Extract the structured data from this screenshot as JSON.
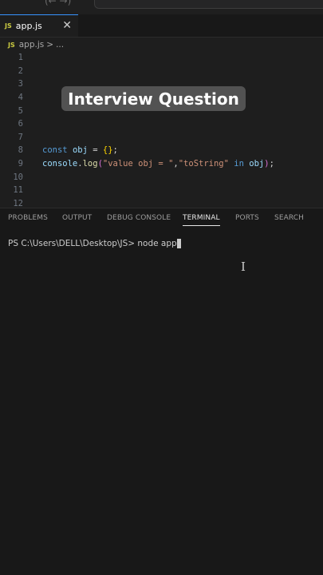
{
  "titlebar": {
    "nav_text": "(← →)"
  },
  "tab": {
    "icon": "JS",
    "label": "app.js",
    "close": "✕"
  },
  "breadcrumb": {
    "icon": "JS",
    "file": "app.js",
    "separator": ">",
    "more": "..."
  },
  "editor": {
    "line_numbers": [
      "1",
      "2",
      "3",
      "4",
      "5",
      "6",
      "7",
      "8",
      "9",
      "10",
      "11",
      "12"
    ],
    "line8": {
      "kw": "const",
      "var": "obj",
      "eq": "=",
      "braces": "{}",
      "semi": ";"
    },
    "line9": {
      "obj": "console",
      "dot": ".",
      "fn": "log",
      "open": "(",
      "str1": "\"value obj = \"",
      "comma": ",",
      "str2": "\"toString\"",
      "kw": "in",
      "var": "obj",
      "close": ")",
      "semi": ";"
    }
  },
  "overlay": {
    "text": "Interview Question"
  },
  "panel": {
    "tabs": [
      "PROBLEMS",
      "OUTPUT",
      "DEBUG CONSOLE",
      "TERMINAL",
      "PORTS",
      "SEARCH"
    ],
    "active_tab": "TERMINAL"
  },
  "terminal": {
    "prompt": "PS C:\\Users\\DELL\\Desktop\\JS>",
    "command": "node app"
  }
}
